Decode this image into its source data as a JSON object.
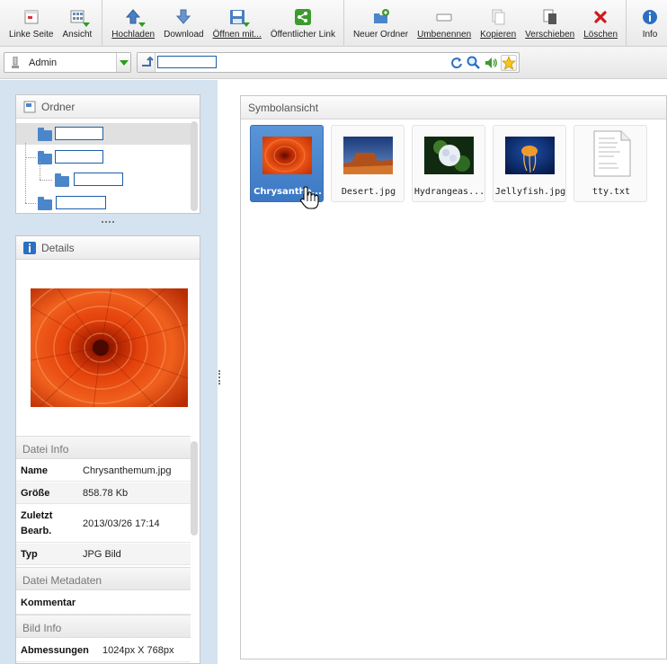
{
  "toolbar": {
    "groups": [
      [
        {
          "label": "Linke Seite",
          "icon": "left-page-icon",
          "underline": false
        },
        {
          "label": "Ansicht",
          "icon": "view-grid-icon",
          "underline": false
        }
      ],
      [
        {
          "label": "Hochladen",
          "icon": "upload-arrow-icon",
          "underline": true
        },
        {
          "label": "Download",
          "icon": "download-arrow-icon",
          "underline": false
        },
        {
          "label": "Öffnen mit...",
          "icon": "open-with-disk-icon",
          "underline": true
        },
        {
          "label": "Öffentlicher Link",
          "icon": "share-icon",
          "underline": false
        }
      ],
      [
        {
          "label": "Neuer Ordner",
          "icon": "new-folder-icon",
          "underline": false
        },
        {
          "label": "Umbenennen",
          "icon": "rename-icon",
          "underline": true
        },
        {
          "label": "Kopieren",
          "icon": "copy-icon",
          "underline": true
        },
        {
          "label": "Verschieben",
          "icon": "move-icon",
          "underline": true
        },
        {
          "label": "Löschen",
          "icon": "delete-icon",
          "underline": true
        }
      ],
      [
        {
          "label": "Info",
          "icon": "info-icon",
          "underline": false
        }
      ]
    ]
  },
  "addressbar": {
    "user": "Admin",
    "path": ""
  },
  "folders": {
    "title": "Ordner"
  },
  "details": {
    "title": "Details",
    "file_info_title": "Datei Info",
    "file_info": [
      {
        "key": "Name",
        "value": "Chrysanthemum.jpg"
      },
      {
        "key": "Größe",
        "value": "858.78 Kb"
      },
      {
        "key": "Zuletzt Bearb.",
        "value": "2013/03/26 17:14"
      },
      {
        "key": "Typ",
        "value": "JPG Bild"
      }
    ],
    "metadata_title": "Datei Metadaten",
    "metadata": [
      {
        "key": "Kommentar",
        "value": ""
      }
    ],
    "image_info_title": "Bild Info",
    "image_info": [
      {
        "key": "Abmessungen",
        "value": "1024px X 768px"
      }
    ]
  },
  "main": {
    "title": "Symbolansicht",
    "files": [
      {
        "name": "Chrysanthe...",
        "selected": true,
        "thumb": "flower"
      },
      {
        "name": "Desert.jpg",
        "selected": false,
        "thumb": "desert"
      },
      {
        "name": "Hydrangeas...",
        "selected": false,
        "thumb": "hydrangea"
      },
      {
        "name": "Jellyfish.jpg",
        "selected": false,
        "thumb": "jellyfish"
      },
      {
        "name": "tty.txt",
        "selected": false,
        "thumb": "text"
      }
    ]
  },
  "colors": {
    "accent": "#3b78c3",
    "panel_bg": "#d5e2ef",
    "green": "#2e9b1f",
    "delete_red": "#d11a1a"
  }
}
